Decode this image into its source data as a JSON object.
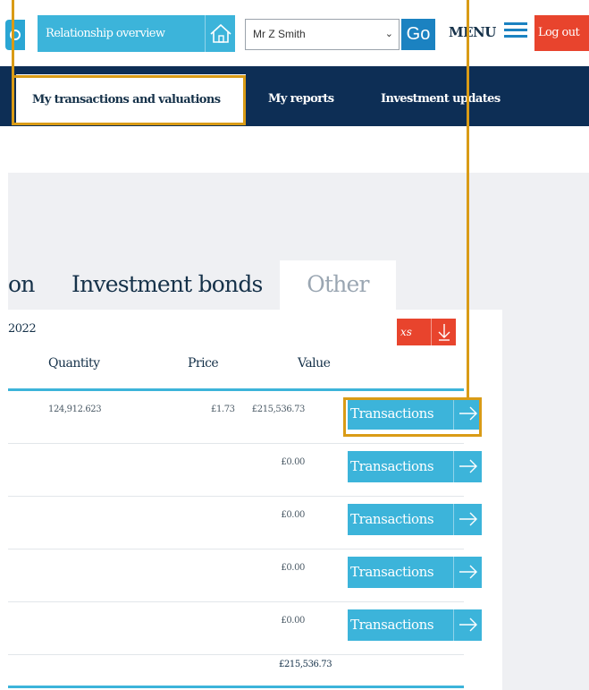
{
  "header": {
    "relationship_label": "Relationship overview",
    "client_selected": "Mr Z Smith",
    "go_label": "Go",
    "menu_label": "MENU",
    "logout_label": "Log out"
  },
  "nav": {
    "items": [
      {
        "label": "My transactions and valuations",
        "active": true
      },
      {
        "label": "My reports",
        "active": false
      },
      {
        "label": "Investment updates",
        "active": false
      }
    ]
  },
  "tabs": {
    "partial_label": "on",
    "bonds_label": "Investment bonds",
    "other_label": "Other"
  },
  "table": {
    "date_fragment": "2022",
    "export_fragment": "xs",
    "headers": {
      "quantity": "Quantity",
      "price": "Price",
      "value": "Value"
    },
    "rows": [
      {
        "quantity": "124,912.623",
        "price": "£1.73",
        "value": "£215,536.73",
        "action": "Transactions"
      },
      {
        "quantity": "",
        "price": "",
        "value": "£0.00",
        "action": "Transactions"
      },
      {
        "quantity": "",
        "price": "",
        "value": "£0.00",
        "action": "Transactions"
      },
      {
        "quantity": "",
        "price": "",
        "value": "£0.00",
        "action": "Transactions"
      },
      {
        "quantity": "",
        "price": "",
        "value": "£0.00",
        "action": "Transactions"
      }
    ],
    "total_value": "£215,536.73"
  },
  "colors": {
    "navy": "#0d2e55",
    "accent_blue": "#3cb4da",
    "logout_red": "#e8442d",
    "highlight_gold": "#d99b16"
  }
}
